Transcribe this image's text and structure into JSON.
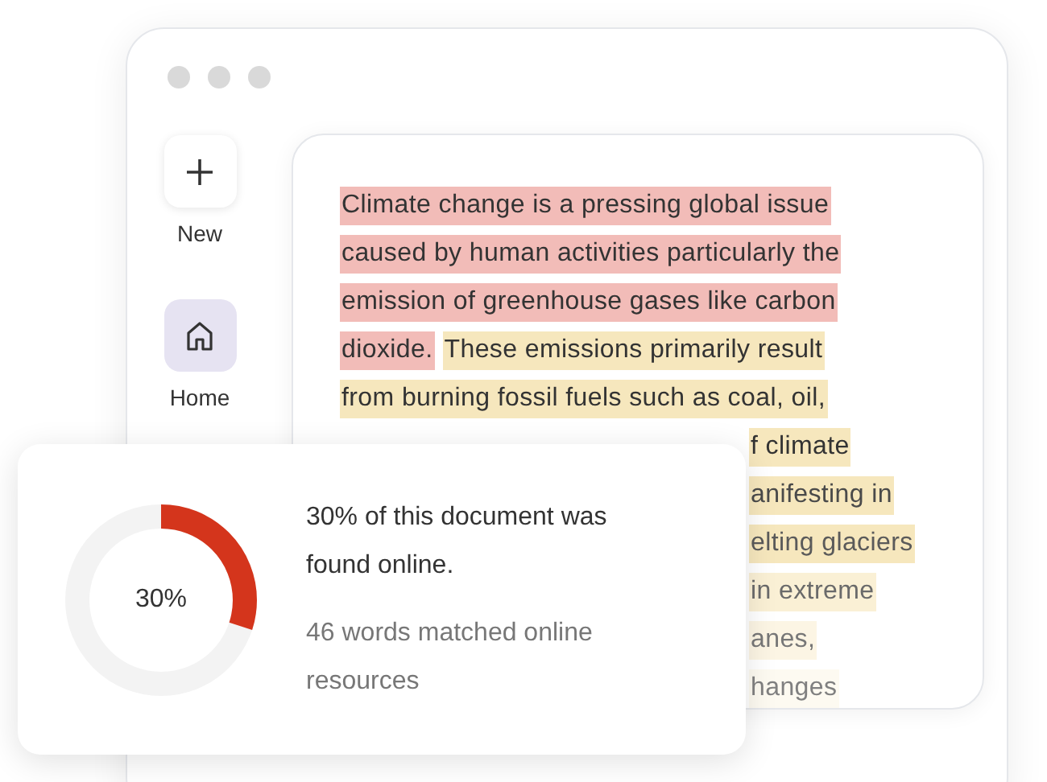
{
  "sidebar": {
    "items": [
      {
        "kind": "new",
        "label": "New",
        "selected": false
      },
      {
        "kind": "home",
        "label": "Home",
        "selected": true
      }
    ]
  },
  "document": {
    "lines": [
      {
        "kind": "full",
        "runs": [
          {
            "text": "Climate change is a pressing global issue",
            "color": "#f2bcb8"
          }
        ]
      },
      {
        "kind": "full",
        "runs": [
          {
            "text": "caused by human activities particularly the",
            "color": "#f2bcb8"
          }
        ]
      },
      {
        "kind": "full",
        "runs": [
          {
            "text": "emission of greenhouse gases like carbon",
            "color": "#f2bcb8"
          }
        ]
      },
      {
        "kind": "full",
        "runs": [
          {
            "text": "dioxide.",
            "color": "#f2bcb8"
          },
          {
            "text": "These emissions primarily result",
            "color": "#f6e7bd"
          }
        ]
      },
      {
        "kind": "full",
        "runs": [
          {
            "text": "from burning fossil fuels such as coal, oil,",
            "color": "#f6e7bd"
          }
        ]
      },
      {
        "kind": "clipped",
        "runs": [
          {
            "text": "f climate",
            "color": "#f6e7bd"
          }
        ]
      },
      {
        "kind": "clipped",
        "runs": [
          {
            "text": "anifesting in",
            "color": "#f6e7bd"
          }
        ]
      },
      {
        "kind": "clipped",
        "runs": [
          {
            "text": "elting glaciers",
            "color": "#f6e7bd"
          }
        ]
      },
      {
        "kind": "clipped",
        "runs": [
          {
            "text": "in extreme",
            "color": "#faf0d5"
          }
        ]
      },
      {
        "kind": "clipped",
        "runs": [
          {
            "text": "anes,",
            "color": "#fcf5e4"
          }
        ]
      },
      {
        "kind": "clipped",
        "runs": [
          {
            "text": "hanges",
            "color": "#fdfaf1"
          }
        ]
      }
    ]
  },
  "result_card": {
    "donut": {
      "level": 0.3,
      "label": "30%"
    },
    "headline": "30% of this document was found online.",
    "detail": "46 words matched online resources"
  }
}
